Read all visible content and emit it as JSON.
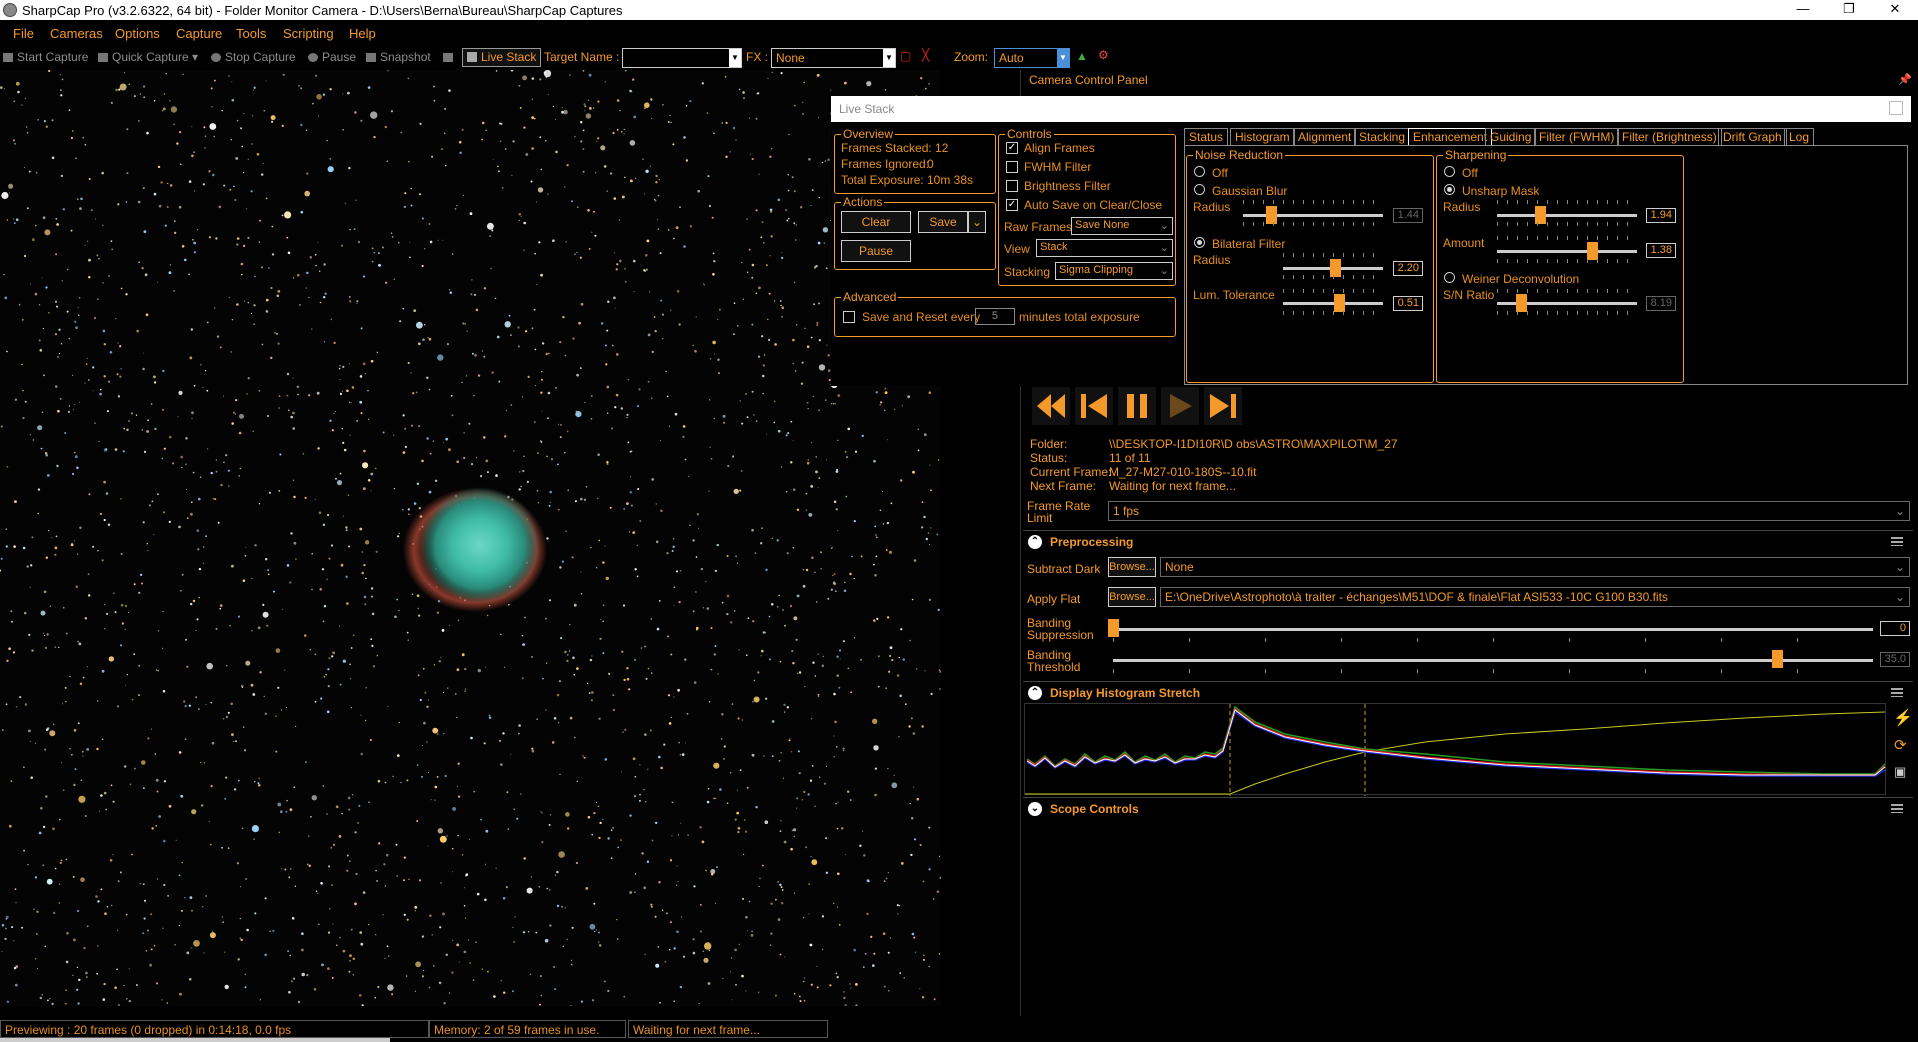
{
  "window": {
    "title": "SharpCap Pro (v3.2.6322, 64 bit) - Folder Monitor Camera - D:\\Users\\Berna\\Bureau\\SharpCap Captures"
  },
  "menu": [
    "File",
    "Cameras",
    "Options",
    "Capture",
    "Tools",
    "Scripting",
    "Help"
  ],
  "toolbar": {
    "start_capture": "Start Capture",
    "quick_capture": "Quick Capture",
    "stop_capture": "Stop Capture",
    "pause": "Pause",
    "snapshot": "Snapshot",
    "live_stack": "Live Stack",
    "target_name_label": "Target Name :",
    "target_name_value": "",
    "fx_label": "FX :",
    "fx_value": "None",
    "zoom_label": "Zoom:",
    "zoom_value": "Auto"
  },
  "status": {
    "previewing": "Previewing : 20 frames (0 dropped) in 0:14:18, 0.0 fps",
    "memory": "Memory: 2 of 59 frames in use.",
    "waiting": "Waiting for next frame..."
  },
  "ccp": {
    "title": "Camera Control Panel"
  },
  "livestack": {
    "title": "Live Stack",
    "overview": {
      "label": "Overview",
      "frames_stacked": "Frames Stacked: 12",
      "frames_ignored_label": "Frames Ignored:",
      "frames_ignored": "0",
      "total_exposure_label": "Total Exposure:",
      "total_exposure": "10m 38s"
    },
    "actions": {
      "label": "Actions",
      "clear": "Clear",
      "save": "Save",
      "pause": "Pause"
    },
    "controls": {
      "label": "Controls",
      "align_frames": "Align Frames",
      "fwhm_filter": "FWHM Filter",
      "brightness_filter": "Brightness Filter",
      "auto_save": "Auto Save on Clear/Close",
      "raw_frames_label": "Raw Frames",
      "raw_frames_value": "Save None",
      "view_label": "View",
      "view_value": "Stack",
      "stacking_label": "Stacking",
      "stacking_value": "Sigma Clipping"
    },
    "advanced": {
      "label": "Advanced",
      "save_reset": "Save and Reset every",
      "minutes_value": "5",
      "minutes_suffix": "minutes total exposure"
    },
    "tabs": [
      "Status",
      "Histogram",
      "Alignment",
      "Stacking",
      "Enhancement",
      "Guiding",
      "Filter (FWHM)",
      "Filter (Brightness)",
      "Drift Graph",
      "Log"
    ],
    "noise_reduction": {
      "label": "Noise Reduction",
      "off": "Off",
      "gaussian": "Gaussian Blur",
      "radius_label": "Radius",
      "gauss_radius": "1.44",
      "bilateral": "Bilateral Filter",
      "bil_radius_label": "Radius",
      "bil_radius": "2.20",
      "lum_label": "Lum. Tolerance",
      "lum_value": "0.51"
    },
    "sharpening": {
      "label": "Sharpening",
      "off": "Off",
      "unsharp": "Unsharp Mask",
      "radius_label": "Radius",
      "radius": "1.94",
      "amount_label": "Amount",
      "amount": "1.38",
      "weiner": "Weiner Deconvolution",
      "sn_label": "S/N Ratio",
      "sn_value": "8.19"
    }
  },
  "folder": {
    "folder_label": "Folder:",
    "folder_value": "\\\\DESKTOP-I1DI10R\\D obs\\ASTRO\\MAXPILOT\\M_27",
    "status_label": "Status:",
    "status_value": "11 of 11",
    "current_label": "Current Frame:",
    "current_value": "M_27-M27-010-180S--10.fit",
    "next_label": "Next Frame:",
    "next_value": "Waiting for next frame...",
    "frame_rate_label": "Frame Rate Limit",
    "frame_rate_value": "1 fps"
  },
  "preprocessing": {
    "title": "Preprocessing",
    "subtract_dark_label": "Subtract Dark",
    "browse": "Browse...",
    "dark_value": "None",
    "apply_flat_label": "Apply Flat",
    "flat_value": "E:\\OneDrive\\Astrophoto\\à traiter - échanges\\M51\\DOF & finale\\Flat ASI533 -10C G100 B30.fits",
    "banding_supp_label": "Banding Suppression",
    "banding_supp_value": "0",
    "banding_thr_label": "Banding Threshold",
    "banding_thr_value": "35.0"
  },
  "histogram": {
    "title": "Display Histogram Stretch"
  },
  "scope": {
    "title": "Scope Controls"
  },
  "colors": {
    "accent": "#f39a2b",
    "nebula_core": "#3fc6b0",
    "nebula_rim": "#c0503a"
  }
}
